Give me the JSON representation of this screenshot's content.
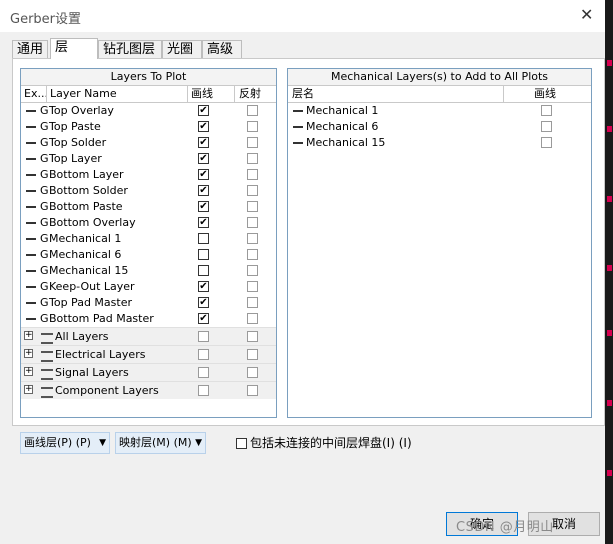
{
  "window": {
    "title": "Gerber设置",
    "close_glyph": "✕"
  },
  "tabs": [
    {
      "label": "通用"
    },
    {
      "label": "层"
    },
    {
      "label": "钻孔图层"
    },
    {
      "label": "光圈"
    },
    {
      "label": "高级"
    }
  ],
  "left_panel": {
    "title": "Layers To Plot",
    "col_ex": "Ex...",
    "col_name": "Layer Name",
    "col_plot": "画线",
    "col_mirror": "反射",
    "layers": [
      {
        "g": "G",
        "name": "Top Overlay",
        "plot": true,
        "mirror": false
      },
      {
        "g": "G",
        "name": "Top Paste",
        "plot": true,
        "mirror": false
      },
      {
        "g": "G",
        "name": "Top Solder",
        "plot": true,
        "mirror": false
      },
      {
        "g": "G",
        "name": "Top Layer",
        "plot": true,
        "mirror": false
      },
      {
        "g": "G",
        "name": "Bottom Layer",
        "plot": true,
        "mirror": false
      },
      {
        "g": "G",
        "name": "Bottom Solder",
        "plot": true,
        "mirror": false
      },
      {
        "g": "G",
        "name": "Bottom Paste",
        "plot": true,
        "mirror": false
      },
      {
        "g": "G",
        "name": "Bottom Overlay",
        "plot": true,
        "mirror": false
      },
      {
        "g": "G",
        "name": "Mechanical 1",
        "plot": false,
        "mirror": false
      },
      {
        "g": "G",
        "name": "Mechanical 6",
        "plot": false,
        "mirror": false
      },
      {
        "g": "G",
        "name": "Mechanical 15",
        "plot": false,
        "mirror": false
      },
      {
        "g": "G",
        "name": "Keep-Out Layer",
        "plot": true,
        "mirror": false
      },
      {
        "g": "G",
        "name": "Top Pad Master",
        "plot": true,
        "mirror": false
      },
      {
        "g": "G",
        "name": "Bottom Pad Master",
        "plot": true,
        "mirror": false
      }
    ],
    "groups": [
      {
        "expand": "+",
        "name": "All Layers"
      },
      {
        "expand": "+",
        "name": "Electrical Layers"
      },
      {
        "expand": "+",
        "name": "Signal Layers"
      },
      {
        "expand": "+",
        "name": "Component Layers"
      }
    ]
  },
  "right_panel": {
    "title": "Mechanical Layers(s) to Add to All Plots",
    "col_name": "层名",
    "col_plot": "画线",
    "layers": [
      {
        "name": "Mechanical 1",
        "plot": false
      },
      {
        "name": "Mechanical 6",
        "plot": false
      },
      {
        "name": "Mechanical 15",
        "plot": false
      }
    ]
  },
  "bottom": {
    "plot_layers_dropdown": "画线层(P) (P)",
    "map_layers_dropdown": "映射层(M) (M)",
    "include_checkbox_label": "包括未连接的中间层焊盘(I) (I)",
    "include_checked": false,
    "dropdown_arrow": "▼",
    "check_glyph": "✔"
  },
  "buttons": {
    "ok": "确定",
    "cancel": "取消"
  },
  "watermark": "CSDN @月明山",
  "colors": {
    "panel_border": "#7a9fbf",
    "ok_border": "#0078d7",
    "dropdown_bg": "#e4eef8",
    "side_mark": "#d6004f"
  }
}
